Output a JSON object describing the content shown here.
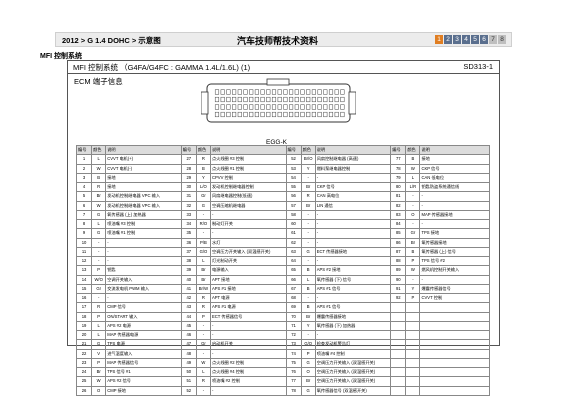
{
  "header": {
    "breadcrumb": "2012 > G 1.4 DOHC > 示意图",
    "title": "汽车技师帮技术资料",
    "pages": [
      "1",
      "2",
      "3",
      "4",
      "5",
      "6",
      "7",
      "8"
    ],
    "active_page": "1"
  },
  "subsystem": "MFI 控制系统",
  "frame": {
    "title": "MFI 控制系统 （G4FA/G4FC : GAMMA 1.4L/1.6L) (1)",
    "code": "SD313-1",
    "ecm_label": "ECM 端子信息",
    "connector_label": "EGG-K"
  },
  "table": {
    "headers": [
      "编号",
      "颜色",
      "说明",
      "编号",
      "颜色",
      "说明",
      "编号",
      "颜色",
      "说明",
      "编号",
      "颜色",
      "说明"
    ],
    "rows": [
      [
        "1",
        "L",
        "CVVT 电机(+)",
        "27",
        "R",
        "点火线圈 #3 控制",
        "52",
        "Br/O",
        "风扇控制继电器 (高速)",
        "77",
        "B",
        "接地"
      ],
      [
        "2",
        "W",
        "CVVT 电机(-)",
        "28",
        "B",
        "点火线圈 #1 控制",
        "53",
        "Y",
        "燃料泵继电器控制",
        "78",
        "W",
        "CKP 信号"
      ],
      [
        "3",
        "B",
        "接地",
        "29",
        "Y",
        "CPVV 控制",
        "54",
        "-",
        "-",
        "79",
        "L",
        "CAN 低电位"
      ],
      [
        "4",
        "R",
        "接地",
        "30",
        "L/O",
        "发动机控制继电器控制",
        "55",
        "Br",
        "CKP 信号",
        "80",
        "L/R",
        "钥匙防盗系统通信线"
      ],
      [
        "5",
        "Br",
        "发动机控制继电器 VPC 输入",
        "31",
        "Gr",
        "风扇继电器控制(低速)",
        "56",
        "R",
        "CAN 高电位",
        "81",
        "-",
        "-"
      ],
      [
        "6",
        "W",
        "发动机控制继电器 VPC 输入",
        "32",
        "G",
        "空调压缩机继电器",
        "57",
        "Br",
        "LIN 通信",
        "82",
        "-",
        "-"
      ],
      [
        "7",
        "G",
        "氧传感器 (上) 加热器",
        "33",
        "-",
        "-",
        "58",
        "-",
        "-",
        "83",
        "O",
        "MAP 传感器接地"
      ],
      [
        "8",
        "L",
        "喷油嘴 #3 控制",
        "34",
        "R/O",
        "制动灯开关",
        "60",
        "-",
        "-",
        "84",
        "-",
        "-"
      ],
      [
        "9",
        "G",
        "喷油嘴 #1 控制",
        "35",
        "-",
        "-",
        "61",
        "-",
        "-",
        "85",
        "Gr",
        "TPS 接地"
      ],
      [
        "10",
        "-",
        "-",
        "36",
        "P/B",
        "水灯",
        "62",
        "-",
        "-",
        "86",
        "Br",
        "氧传感器接地"
      ],
      [
        "11",
        "-",
        "-",
        "37",
        "G/O",
        "空调压力开关输入 (双温感开关)",
        "63",
        "G",
        "ECT 传感器接地",
        "87",
        "B",
        "氧传感器 (上) 信号"
      ],
      [
        "12",
        "-",
        "-",
        "38",
        "L",
        "灯光制动开关",
        "64",
        "-",
        "-",
        "88",
        "P",
        "TPS 信号 #2"
      ],
      [
        "13",
        "P",
        "钥匙",
        "39",
        "Br",
        "电源输入",
        "65",
        "B",
        "APS #2 接地",
        "89",
        "W",
        "燃风机控制开关输入"
      ],
      [
        "14",
        "W/O",
        "空调开关输入",
        "40",
        "Br",
        "APT 接地",
        "66",
        "L",
        "氧传感器 (下) 信号",
        "90",
        "-",
        "-"
      ],
      [
        "15",
        "Gr",
        "交流发电机 PWM 输入",
        "41",
        "Br/W",
        "APS #1 接地",
        "67",
        "B",
        "APS #1 信号",
        "91",
        "Y",
        "爆震传感器信号"
      ],
      [
        "16",
        "-",
        "-",
        "42",
        "R",
        "APT 电源",
        "68",
        "-",
        "-",
        "92",
        "P",
        "CVVT 控制"
      ],
      [
        "17",
        "R",
        "CMP 信号",
        "43",
        "R",
        "APS #1 电源",
        "69",
        "B",
        "APS #1 信号",
        "",
        "",
        ""
      ],
      [
        "18",
        "P",
        "ON/START 输入",
        "44",
        "P",
        "ECT 传感器信号",
        "70",
        "Br",
        "爆震传感器接地",
        "",
        "",
        ""
      ],
      [
        "19",
        "L",
        "APS #2 电源",
        "45",
        "-",
        "-",
        "71",
        "Y",
        "氧传感器 (下) 加热器",
        "",
        "",
        ""
      ],
      [
        "20",
        "L",
        "MAP 传感器电源",
        "46",
        "-",
        "-",
        "72",
        "-",
        "-",
        "",
        "",
        ""
      ],
      [
        "21",
        "G",
        "TPS 电源",
        "47",
        "Gr",
        "启动机开关",
        "73",
        "G/O",
        "检查发动机警告灯",
        "",
        "",
        ""
      ],
      [
        "22",
        "V",
        "进气温度输入",
        "48",
        "-",
        "-",
        "74",
        "P",
        "喷油嘴 #4 控制",
        "",
        "",
        ""
      ],
      [
        "23",
        "P",
        "MAP 传感器信号",
        "49",
        "W",
        "点火线圈 #2 控制",
        "75",
        "G",
        "空调压力开关输入 (双温感开关)",
        "",
        "",
        ""
      ],
      [
        "24",
        "Br",
        "TPS 信号 #1",
        "50",
        "L",
        "点火线圈 #4 控制",
        "76",
        "O",
        "空调压力开关输入 (双温感开关)",
        "",
        "",
        ""
      ],
      [
        "25",
        "W",
        "APS #2 信号",
        "51",
        "R",
        "喷油嘴 #2 控制",
        "77",
        "Br",
        "空调压力开关输入 (双温感开关)",
        "",
        "",
        ""
      ],
      [
        "26",
        "O",
        "CMP 接地",
        "52",
        "-",
        "-",
        "78",
        "G",
        "氧传感器信号 (双温感开关)",
        "",
        "",
        ""
      ]
    ]
  }
}
